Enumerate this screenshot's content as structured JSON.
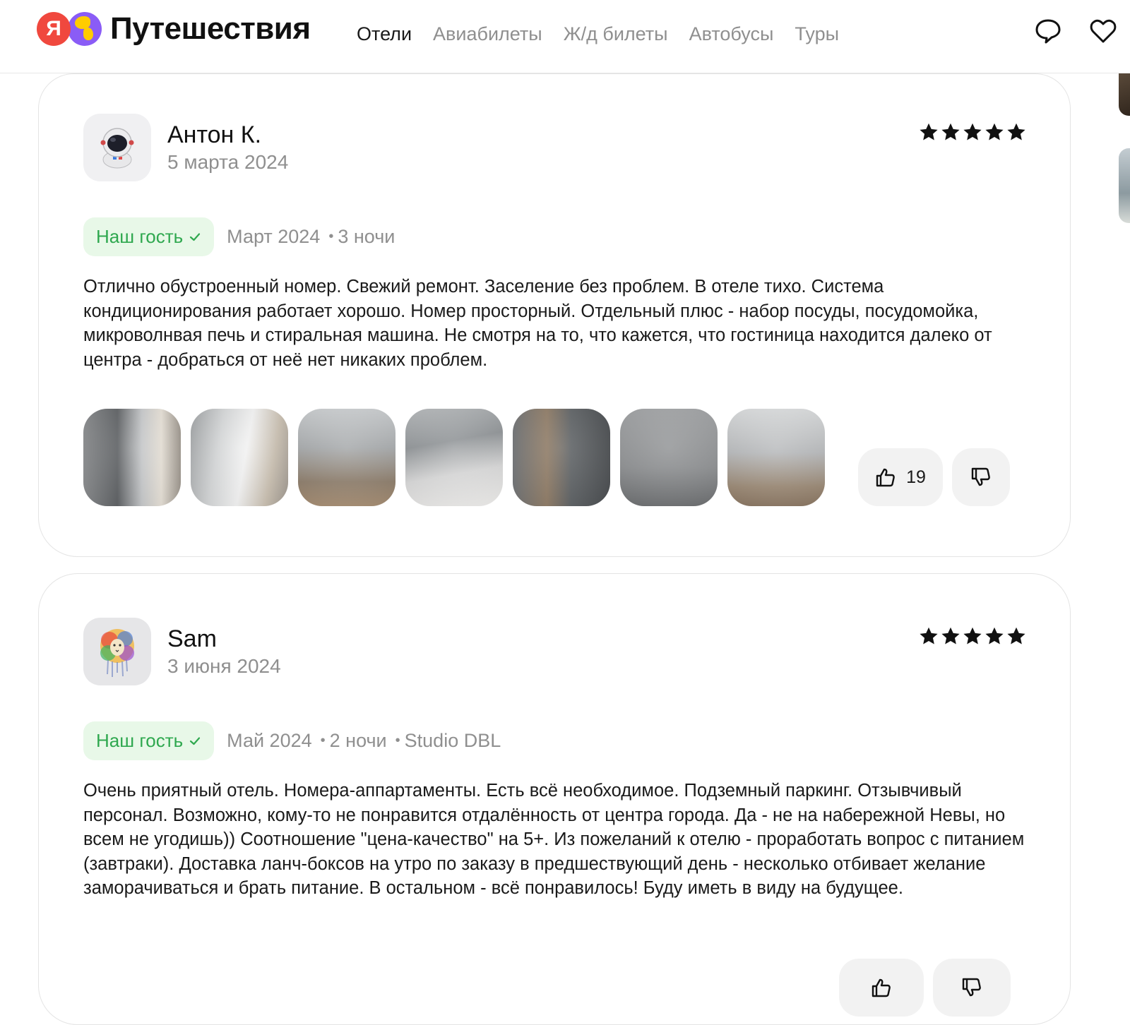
{
  "header": {
    "logo_letter": "Я",
    "logo_text": "Путешествия",
    "nav": [
      {
        "label": "Отели",
        "active": true
      },
      {
        "label": "Авиабилеты",
        "active": false
      },
      {
        "label": "Ж/д билеты",
        "active": false
      },
      {
        "label": "Автобусы",
        "active": false
      },
      {
        "label": "Туры",
        "active": false
      }
    ],
    "icons": [
      "chat-icon",
      "heart-icon"
    ]
  },
  "reviews": [
    {
      "author": "Антон К.",
      "date": "5 марта 2024",
      "rating": 5,
      "avatar_icon": "astronaut-icon",
      "badge": "Наш гость",
      "stay_date": "Март 2024",
      "nights": "3 ночи",
      "room": "",
      "text": "Отлично обустроенный номер. Свежий ремонт. Заселение без проблем. В отеле тихо. Система кондиционирования работает хорошо. Номер просторный. Отдельный плюс - набор посуды, посудомойка, микроволнвая печь и стиральная машина. Не смотря на то, что кажется, что гостиница находится далеко от центра - добраться от неё нет никаких проблем.",
      "photos_count": 7,
      "likes": "19"
    },
    {
      "author": "Sam",
      "date": "3 июня 2024",
      "rating": 5,
      "avatar_icon": "colorful-lion-icon",
      "badge": "Наш гость",
      "stay_date": "Май 2024",
      "nights": "2 ночи",
      "room": "Studio DBL",
      "text": "Очень приятный отель. Номера-аппартаменты. Есть всё необходимое. Подземный паркинг. Отзывчивый персонал. Возможно, кому-то не понравится отдалённость от центра города. Да - не на набережной Невы, но всем не угодишь)) Соотношение \"цена-качество\" на 5+. Из пожеланий к отелю - проработать вопрос с питанием (завтраки). Доставка ланч-боксов на утро по заказу в предшествующий день - несколько отбивает желание заморачиваться и брать питание. В остальном - всё понравилось! Буду иметь в виду на будущее."
    }
  ],
  "colors": {
    "badge_bg": "#e8f8e8",
    "badge_text": "#2fa84f",
    "logo_red": "#f0483e",
    "logo_purple": "#8a5cf6",
    "muted_text": "#8f8f8f"
  }
}
